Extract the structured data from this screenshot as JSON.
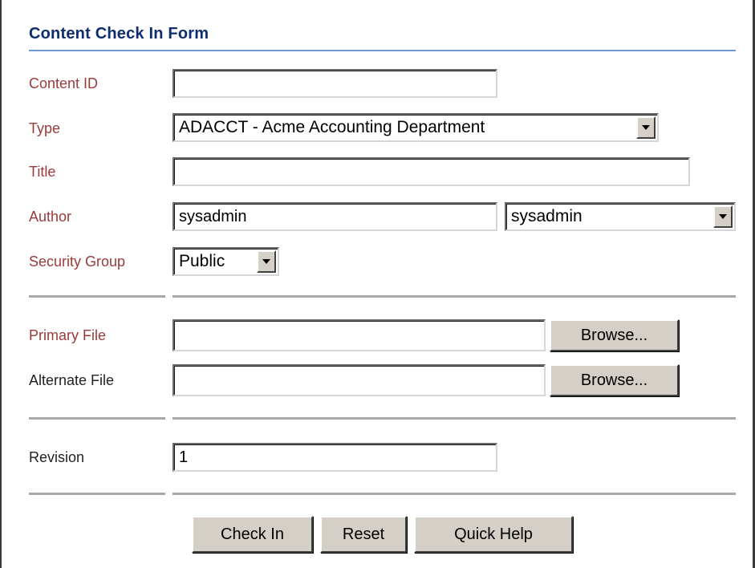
{
  "form": {
    "title": "Content Check In Form",
    "fields": {
      "content_id": {
        "label": "Content ID",
        "value": ""
      },
      "type": {
        "label": "Type",
        "selected": "ADACCT - Acme Accounting Department"
      },
      "title": {
        "label": "Title",
        "value": ""
      },
      "author": {
        "label": "Author",
        "value": "sysadmin",
        "selected": "sysadmin"
      },
      "security_group": {
        "label": "Security Group",
        "selected": "Public"
      },
      "primary_file": {
        "label": "Primary File",
        "value": "",
        "browse_label": "Browse..."
      },
      "alternate_file": {
        "label": "Alternate File",
        "value": "",
        "browse_label": "Browse..."
      },
      "revision": {
        "label": "Revision",
        "value": "1"
      }
    },
    "buttons": {
      "check_in": "Check In",
      "reset": "Reset",
      "quick_help": "Quick Help"
    }
  },
  "colors": {
    "title": "#0d2d6e",
    "required_label": "#9a3a3a",
    "title_rule": "#6d9ad4",
    "button_face": "#d4d0c8"
  }
}
